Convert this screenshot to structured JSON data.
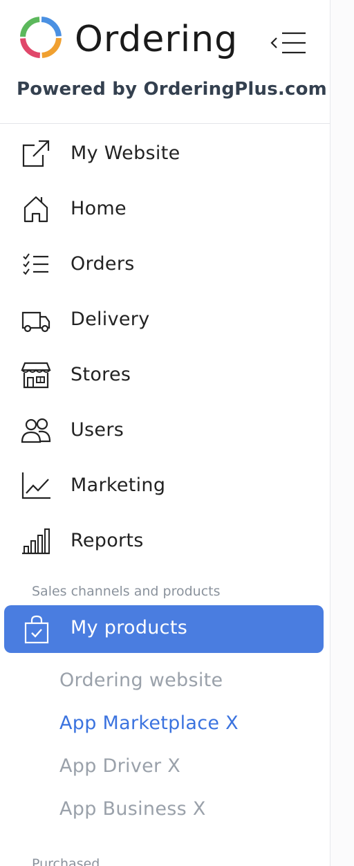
{
  "header": {
    "brand": "Ordering",
    "powered_by": "Powered by OrderingPlus.com",
    "collapse_icon": "menu-collapse-icon"
  },
  "nav": [
    {
      "label": "My Website",
      "icon": "external-link-icon"
    },
    {
      "label": "Home",
      "icon": "home-icon"
    },
    {
      "label": "Orders",
      "icon": "checklist-icon"
    },
    {
      "label": "Delivery",
      "icon": "truck-icon"
    },
    {
      "label": "Stores",
      "icon": "storefront-icon"
    },
    {
      "label": "Users",
      "icon": "users-icon"
    },
    {
      "label": "Marketing",
      "icon": "line-chart-icon"
    },
    {
      "label": "Reports",
      "icon": "bar-chart-icon"
    }
  ],
  "sales_section": {
    "title": "Sales channels and products",
    "active_item": {
      "label": "My products",
      "icon": "shopping-bag-check-icon"
    },
    "sub_items": [
      {
        "label": "Ordering website",
        "selected": false
      },
      {
        "label": "App Marketplace X",
        "selected": true
      },
      {
        "label": "App Driver X",
        "selected": false
      },
      {
        "label": "App Business X",
        "selected": false
      }
    ]
  },
  "purchased_section": {
    "title": "Purchased"
  },
  "colors": {
    "accent": "#4a7de0",
    "selected_link": "#3b73df",
    "muted_text": "#9aa1aa",
    "logo_green": "#5cb85c",
    "logo_blue": "#4a90e2",
    "logo_orange": "#f0a030",
    "logo_red": "#e0476a"
  }
}
